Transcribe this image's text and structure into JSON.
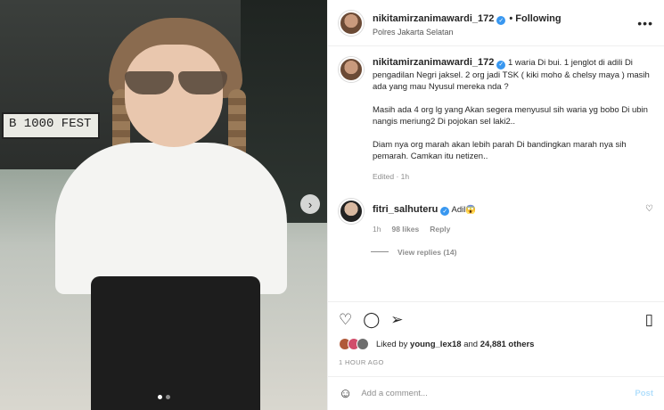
{
  "post": {
    "username": "nikitamirzanimawardi_172",
    "follow_status": "• Following",
    "location": "Polres Jakarta Selatan",
    "image_plate_text": "B 1000 FEST",
    "carousel_next": "›",
    "more_icon": "•••"
  },
  "caption": {
    "username": "nikitamirzanimawardi_172",
    "paragraphs": [
      "1 waria Di bui. 1 jenglot di adili Di pengadilan Negri jaksel. 2 org jadi TSK ( kiki moho & chelsy maya ) masih ada yang mau Nyusul mereka nda ?",
      "Masih ada 4 org lg yang Akan segera menyusul sih waria yg bobo Di ubin nangis meriung2 Di pojokan sel laki2..",
      "Diam nya org marah akan lebih parah Di bandingkan marah nya sih pemarah. Camkan itu netizen.."
    ],
    "edited": "Edited · 1h"
  },
  "comment": {
    "username": "fitri_salhuteru",
    "text": "Adil😱",
    "time": "1h",
    "likes": "98 likes",
    "reply_label": "Reply",
    "view_replies": "View replies (14)"
  },
  "actions": {
    "liked_by_prefix": "Liked by",
    "liked_by_user": "young_lex18",
    "liked_by_suffix": "and",
    "liked_by_count": "24,881 others",
    "time_ago": "1 HOUR AGO"
  },
  "add_comment": {
    "placeholder": "Add a comment...",
    "post_label": "Post"
  },
  "colors": {
    "verified": "#3897f0",
    "post_disabled": "#b2dffc",
    "liker1": "#b05a3a",
    "liker2": "#d14d6b",
    "liker3": "#6d6d6d"
  },
  "icons": {
    "heart": "heart-icon",
    "comment": "comment-icon",
    "share": "share-icon",
    "save": "bookmark-icon",
    "emoji": "emoji-icon"
  }
}
